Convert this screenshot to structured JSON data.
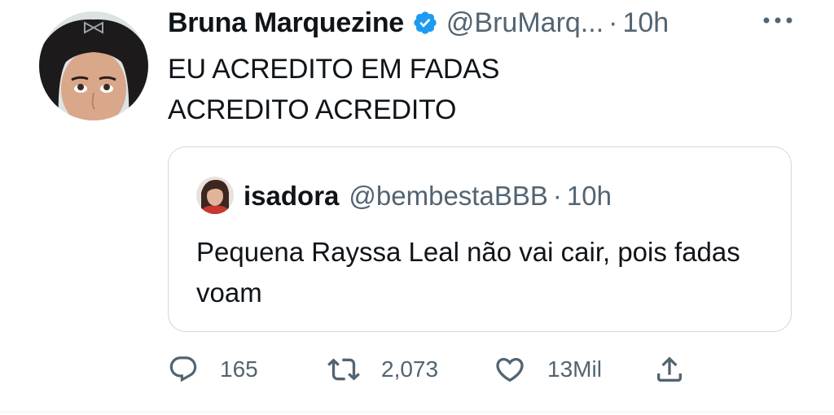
{
  "tweet": {
    "author": {
      "display_name": "Bruna Marquezine",
      "handle": "@BruMarq...",
      "separator": "·",
      "time": "10h"
    },
    "text_lines": [
      "EU ACREDITO EM FADAS",
      "ACREDITO ACREDITO"
    ],
    "quote": {
      "display_name": "isadora",
      "handle": "@bembestaBBB",
      "separator": "·",
      "time": "10h",
      "text": "Pequena Rayssa Leal não vai cair, pois fadas voam"
    },
    "actions": {
      "replies": "165",
      "retweets": "2,073",
      "likes": "13Mil"
    }
  },
  "icons": {
    "verified": "verified-badge-icon",
    "more": "more-dots-icon",
    "reply": "reply-bubble-icon",
    "retweet": "retweet-icon",
    "like": "heart-icon",
    "share": "share-upload-icon"
  },
  "colors": {
    "verified_blue": "#1d9bf0",
    "secondary_text": "#536471",
    "primary_text": "#0f1419",
    "border": "#cfd9de"
  }
}
